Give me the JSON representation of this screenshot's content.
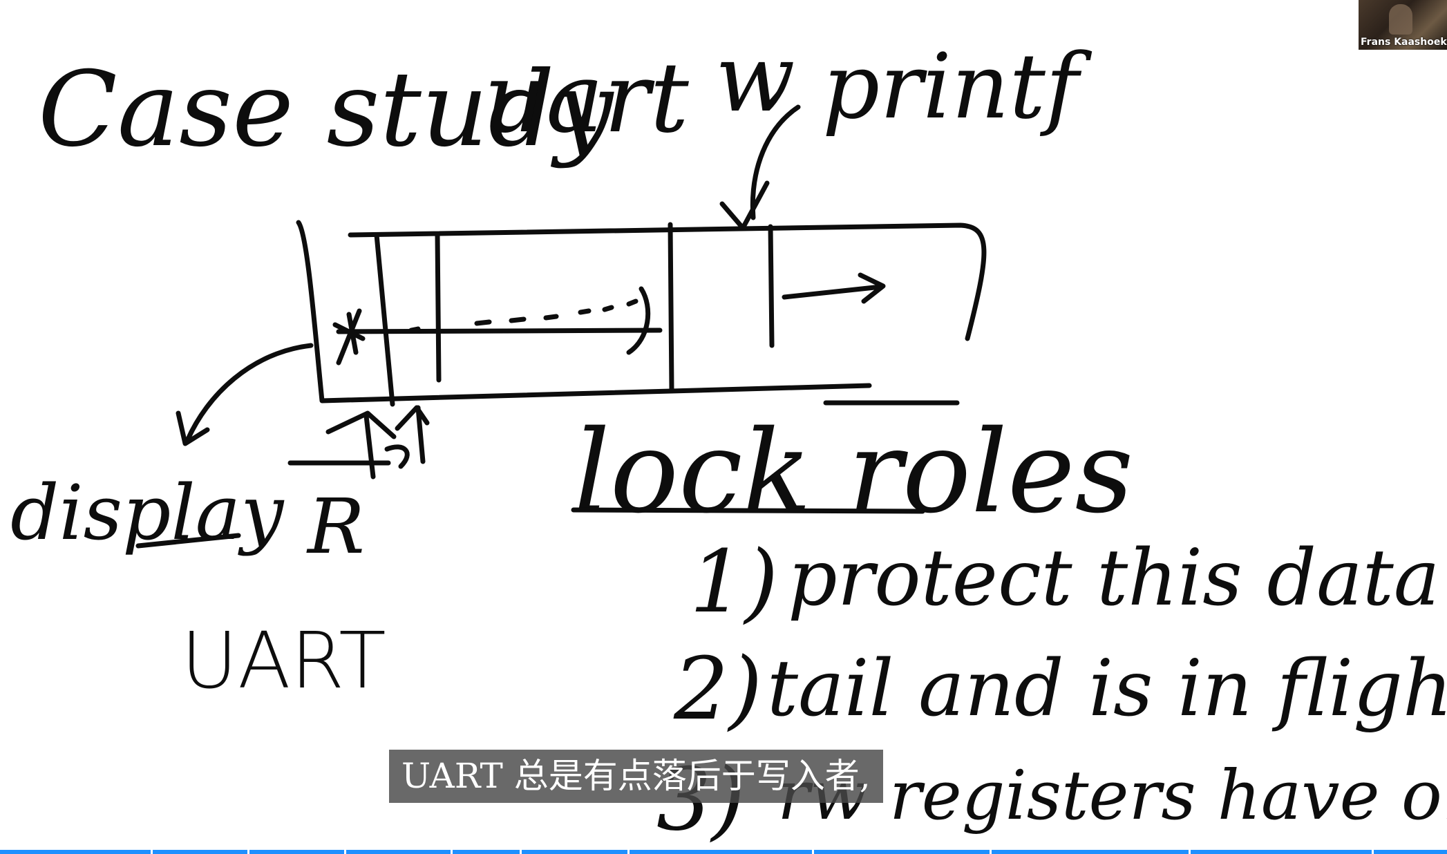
{
  "whiteboard": {
    "title_line": {
      "case_study": "Case study",
      "uart": "uart",
      "w": "w",
      "printf": "printf"
    },
    "labels": {
      "display": "display",
      "r": "R",
      "uart": "UART",
      "lock_roles": "lock roles"
    },
    "list_items": [
      {
        "num": "1)",
        "text": "protect this data str"
      },
      {
        "num": "2)",
        "text": "tail and is in flight"
      },
      {
        "num": "3)",
        "text": "rw registers have one writer"
      }
    ]
  },
  "webcam": {
    "participant_name": "Frans Kaashoek"
  },
  "subtitle": {
    "text": "UART 总是有点落后于写入者,"
  },
  "player": {
    "progress_color": "#1e90ff"
  }
}
